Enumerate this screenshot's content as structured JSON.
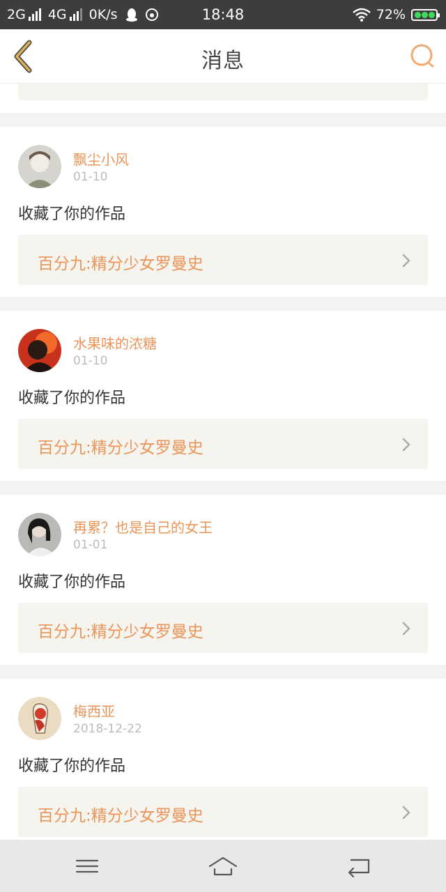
{
  "status_bar": {
    "network1": "2G",
    "network2": "4G",
    "speed": "0K/s",
    "time": "18:48",
    "battery": "72%"
  },
  "header": {
    "title": "消息",
    "back_icon": "chevron-left-icon",
    "search_icon": "search-icon"
  },
  "colors": {
    "accent": "#e9955a",
    "back_icon": "#e0b25a"
  },
  "messages": [
    {
      "name": "飘尘小风",
      "date": "01-10",
      "action": "收藏了你的作品",
      "work": "百分九:精分少女罗曼史"
    },
    {
      "name": "水果味的浓糖",
      "date": "01-10",
      "action": "收藏了你的作品",
      "work": "百分九:精分少女罗曼史"
    },
    {
      "name": "再累？也是自己的女王",
      "date": "01-01",
      "action": "收藏了你的作品",
      "work": "百分九:精分少女罗曼史"
    },
    {
      "name": "梅西亚",
      "date": "2018-12-22",
      "action": "收藏了你的作品",
      "work": "百分九:精分少女罗曼史"
    }
  ],
  "bottom_nav": {
    "menu_icon": "menu-icon",
    "home_icon": "home-icon",
    "back_icon": "back-icon"
  }
}
